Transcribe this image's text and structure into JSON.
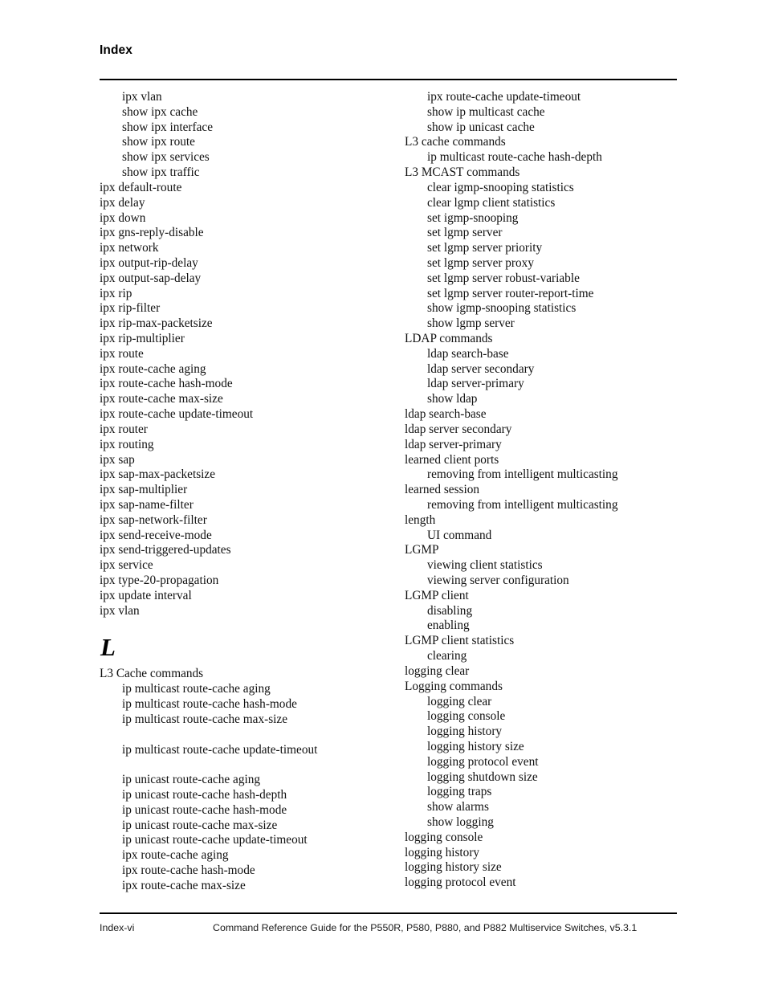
{
  "header": {
    "title": "Index"
  },
  "footer": {
    "page_label": "Index-vi",
    "document_title": "Command Reference Guide for the P550R, P580, P880, and P882 Multiservice Switches, v5.3.1"
  },
  "columns": {
    "left": [
      {
        "level": 1,
        "text": "ipx vlan"
      },
      {
        "level": 1,
        "text": "show ipx cache"
      },
      {
        "level": 1,
        "text": "show ipx interface"
      },
      {
        "level": 1,
        "text": "show ipx route"
      },
      {
        "level": 1,
        "text": "show ipx services"
      },
      {
        "level": 1,
        "text": "show ipx traffic"
      },
      {
        "level": 0,
        "text": "ipx default-route"
      },
      {
        "level": 0,
        "text": "ipx delay"
      },
      {
        "level": 0,
        "text": "ipx down"
      },
      {
        "level": 0,
        "text": "ipx gns-reply-disable"
      },
      {
        "level": 0,
        "text": "ipx network"
      },
      {
        "level": 0,
        "text": "ipx output-rip-delay"
      },
      {
        "level": 0,
        "text": "ipx output-sap-delay"
      },
      {
        "level": 0,
        "text": "ipx rip"
      },
      {
        "level": 0,
        "text": "ipx rip-filter"
      },
      {
        "level": 0,
        "text": "ipx rip-max-packetsize"
      },
      {
        "level": 0,
        "text": "ipx rip-multiplier"
      },
      {
        "level": 0,
        "text": "ipx route"
      },
      {
        "level": 0,
        "text": "ipx route-cache aging"
      },
      {
        "level": 0,
        "text": "ipx route-cache hash-mode"
      },
      {
        "level": 0,
        "text": "ipx route-cache max-size"
      },
      {
        "level": 0,
        "text": "ipx route-cache update-timeout"
      },
      {
        "level": 0,
        "text": "ipx router"
      },
      {
        "level": 0,
        "text": "ipx routing"
      },
      {
        "level": 0,
        "text": "ipx sap"
      },
      {
        "level": 0,
        "text": "ipx sap-max-packetsize"
      },
      {
        "level": 0,
        "text": "ipx sap-multiplier"
      },
      {
        "level": 0,
        "text": "ipx sap-name-filter"
      },
      {
        "level": 0,
        "text": "ipx sap-network-filter"
      },
      {
        "level": 0,
        "text": "ipx send-receive-mode"
      },
      {
        "level": 0,
        "text": "ipx send-triggered-updates"
      },
      {
        "level": 0,
        "text": "ipx service"
      },
      {
        "level": 0,
        "text": "ipx type-20-propagation"
      },
      {
        "level": 0,
        "text": "ipx update interval"
      },
      {
        "level": 0,
        "text": "ipx vlan"
      },
      {
        "letter": "L"
      },
      {
        "level": 0,
        "text": "L3 Cache commands"
      },
      {
        "level": 1,
        "text": "ip multicast route-cache aging"
      },
      {
        "level": 1,
        "text": "ip multicast route-cache hash-mode"
      },
      {
        "level": 1,
        "text": "ip multicast route-cache max-size"
      },
      {
        "level": 1,
        "text": ""
      },
      {
        "level": 1,
        "text": "ip multicast route-cache update-timeout"
      },
      {
        "level": 1,
        "text": ""
      },
      {
        "level": 1,
        "text": "ip unicast route-cache aging"
      },
      {
        "level": 1,
        "text": "ip unicast route-cache hash-depth"
      },
      {
        "level": 1,
        "text": "ip unicast route-cache hash-mode"
      },
      {
        "level": 1,
        "text": "ip unicast route-cache max-size"
      },
      {
        "level": 1,
        "text": "ip unicast route-cache update-timeout"
      },
      {
        "level": 1,
        "text": "ipx route-cache aging"
      },
      {
        "level": 1,
        "text": "ipx route-cache hash-mode"
      },
      {
        "level": 1,
        "text": "ipx route-cache max-size"
      }
    ],
    "right": [
      {
        "level": 1,
        "text": "ipx route-cache update-timeout"
      },
      {
        "level": 1,
        "text": "show ip multicast cache"
      },
      {
        "level": 1,
        "text": "show ip unicast cache"
      },
      {
        "level": 0,
        "text": "L3 cache commands"
      },
      {
        "level": 1,
        "text": "ip multicast route-cache hash-depth"
      },
      {
        "level": 0,
        "text": "L3 MCAST commands"
      },
      {
        "level": 1,
        "text": "clear igmp-snooping statistics"
      },
      {
        "level": 1,
        "text": "clear lgmp client statistics"
      },
      {
        "level": 1,
        "text": "set igmp-snooping"
      },
      {
        "level": 1,
        "text": "set lgmp server"
      },
      {
        "level": 1,
        "text": "set lgmp server priority"
      },
      {
        "level": 1,
        "text": "set lgmp server proxy"
      },
      {
        "level": 1,
        "text": "set lgmp server robust-variable"
      },
      {
        "level": 1,
        "text": "set lgmp server router-report-time"
      },
      {
        "level": 1,
        "text": "show igmp-snooping statistics"
      },
      {
        "level": 1,
        "text": "show lgmp server"
      },
      {
        "level": 0,
        "text": "LDAP commands"
      },
      {
        "level": 1,
        "text": "ldap search-base"
      },
      {
        "level": 1,
        "text": "ldap server secondary"
      },
      {
        "level": 1,
        "text": "ldap server-primary"
      },
      {
        "level": 1,
        "text": "show ldap"
      },
      {
        "level": 0,
        "text": "ldap search-base"
      },
      {
        "level": 0,
        "text": "ldap server secondary"
      },
      {
        "level": 0,
        "text": "ldap server-primary"
      },
      {
        "level": 0,
        "text": "learned client ports"
      },
      {
        "level": 1,
        "text": "removing from intelligent multicasting"
      },
      {
        "level": 0,
        "text": "learned session"
      },
      {
        "level": 1,
        "text": "removing from intelligent multicasting"
      },
      {
        "level": 0,
        "text": "length"
      },
      {
        "level": 1,
        "text": "UI command"
      },
      {
        "level": 0,
        "text": "LGMP"
      },
      {
        "level": 1,
        "text": "viewing client statistics"
      },
      {
        "level": 1,
        "text": "viewing server configuration"
      },
      {
        "level": 0,
        "text": "LGMP client"
      },
      {
        "level": 1,
        "text": "disabling"
      },
      {
        "level": 1,
        "text": "enabling"
      },
      {
        "level": 0,
        "text": "LGMP client statistics"
      },
      {
        "level": 1,
        "text": "clearing"
      },
      {
        "level": 0,
        "text": "logging clear"
      },
      {
        "level": 0,
        "text": "Logging commands"
      },
      {
        "level": 1,
        "text": "logging clear"
      },
      {
        "level": 1,
        "text": "logging console"
      },
      {
        "level": 1,
        "text": "logging history"
      },
      {
        "level": 1,
        "text": "logging history size"
      },
      {
        "level": 1,
        "text": "logging protocol event"
      },
      {
        "level": 1,
        "text": "logging shutdown size"
      },
      {
        "level": 1,
        "text": "logging traps"
      },
      {
        "level": 1,
        "text": "show alarms"
      },
      {
        "level": 1,
        "text": "show logging"
      },
      {
        "level": 0,
        "text": "logging console"
      },
      {
        "level": 0,
        "text": "logging history"
      },
      {
        "level": 0,
        "text": "logging history size"
      },
      {
        "level": 0,
        "text": "logging protocol event"
      }
    ]
  }
}
